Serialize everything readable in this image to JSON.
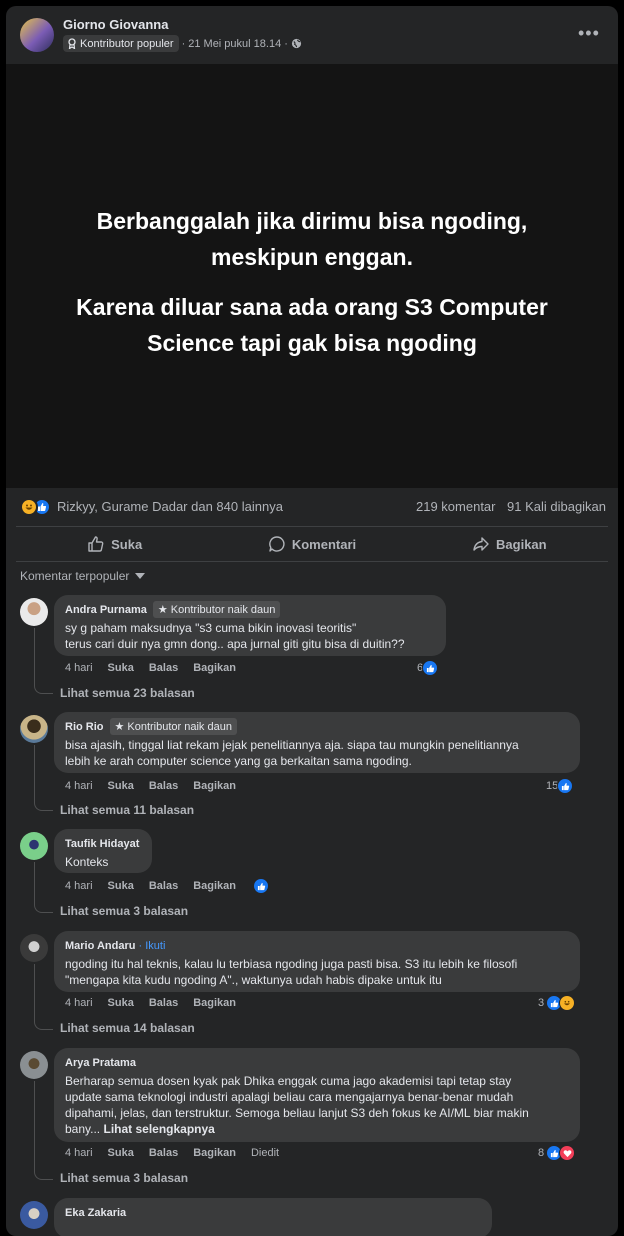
{
  "post": {
    "author": "Giorno Giovanna",
    "badge": "Kontributor populer",
    "time": "21 Mei pukul 18.14",
    "privacy_icon": "globe-icon",
    "image_text": {
      "line1": "Berbanggalah jika dirimu bisa ngoding,",
      "line2": "meskipun enggan.",
      "line3": "Karena diluar sana ada orang S3 Computer",
      "line4": "Science tapi gak bisa ngoding"
    },
    "reactions_summary": "Rizkyy, Gurame Dadar dan 840 lainnya",
    "comments_count": "219 komentar",
    "shares_count": "91 Kali dibagikan"
  },
  "actions": {
    "like": "Suka",
    "comment": "Komentari",
    "share": "Bagikan"
  },
  "sort_label": "Komentar terpopuler",
  "comments": [
    {
      "name": "Andra Purnama",
      "badge": "Kontributor naik daun",
      "line1": "sy g paham maksudnya \"s3 cuma bikin inovasi teoritis\"",
      "line2": "terus cari duir nya gmn dong.. apa jurnal giti gitu bisa di duitin??",
      "time": "4 hari",
      "like": "Suka",
      "reply": "Balas",
      "share": "Bagikan",
      "reactions": "6",
      "view_replies": "Lihat semua 23 balasan"
    },
    {
      "name": "Rio Rio",
      "badge": "Kontributor naik daun",
      "line1": "bisa ajasih, tinggal liat rekam jejak penelitiannya aja. siapa tau mungkin penelitiannya",
      "line2": "lebih ke arah computer science yang ga berkaitan sama ngoding.",
      "time": "4 hari",
      "like": "Suka",
      "reply": "Balas",
      "share": "Bagikan",
      "reactions": "15",
      "view_replies": "Lihat semua 11 balasan"
    },
    {
      "name": "Taufik Hidayat",
      "line1": "Konteks",
      "time": "4 hari",
      "like": "Suka",
      "reply": "Balas",
      "share": "Bagikan",
      "view_replies": "Lihat semua 3 balasan"
    },
    {
      "name": "Mario Andaru",
      "follow": "· Ikuti",
      "line1": "ngoding itu hal teknis, kalau lu terbiasa ngoding juga pasti bisa. S3 itu lebih ke filosofi",
      "line2": "\"mengapa kita kudu ngoding A\"., waktunya udah habis dipake untuk itu",
      "time": "4 hari",
      "like": "Suka",
      "reply": "Balas",
      "share": "Bagikan",
      "reactions": "3",
      "view_replies": "Lihat semua 14 balasan"
    },
    {
      "name": "Arya Pratama",
      "line1": "Berharap semua dosen kyak pak Dhika enggak cuma jago akademisi tapi tetap stay",
      "line2": "update sama teknologi industri apalagi beliau cara mengajarnya benar-benar mudah",
      "line3": "dipahami, jelas, dan terstruktur. Semoga beliau lanjut S3 deh fokus ke AI/ML biar makin",
      "line4": "bany...",
      "see_more": "Lihat selengkapnya",
      "time": "4 hari",
      "like": "Suka",
      "reply": "Balas",
      "share": "Bagikan",
      "edited": "Diedit",
      "reactions": "8",
      "view_replies": "Lihat semua 3 balasan"
    },
    {
      "name": "Eka Zakaria"
    }
  ]
}
